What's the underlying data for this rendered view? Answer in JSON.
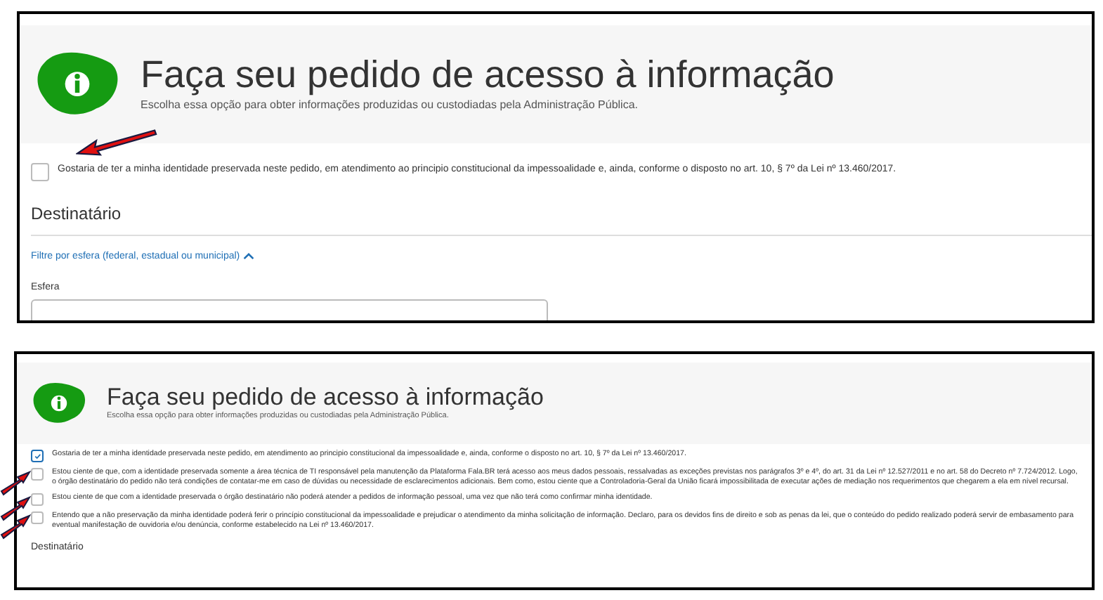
{
  "panels": [
    {
      "header": {
        "title": "Faça seu pedido de acesso à informação",
        "subtitle": "Escolha essa opção para obter informações produzidas ou custodiadas pela Administração Pública."
      },
      "options": [
        {
          "text": "Gostaria de ter a minha identidade preservada neste pedido, em atendimento ao principio constitucional da impessoalidade e, ainda, conforme o disposto no art. 10, § 7º da Lei nº 13.460/2017.",
          "checked": false,
          "marked": true
        }
      ],
      "section": "Destinatário",
      "filter_link": "Filtre por esfera (federal, estadual ou municipal)",
      "field_label": "Esfera"
    },
    {
      "header": {
        "title": "Faça seu pedido de acesso à informação",
        "subtitle": "Escolha essa opção para obter informações produzidas ou custodiadas pela Administração Pública."
      },
      "options": [
        {
          "text": "Gostaria de ter a minha identidade preservada neste pedido, em atendimento ao principio constitucional da impessoalidade e, ainda, conforme o disposto no art. 10, § 7º da Lei nº 13.460/2017.",
          "checked": true,
          "marked": false
        },
        {
          "text": "Estou ciente de que, com a identidade preservada somente a área técnica de TI responsável pela manutenção da Plataforma Fala.BR terá acesso aos meus dados pessoais, ressalvadas as exceções previstas nos parágrafos 3º e 4º, do art. 31 da Lei nº 12.527/2011 e no art. 58 do Decreto nº 7.724/2012. Logo, o órgão destinatário do pedido não terá condições de contatar-me em caso de dúvidas ou necessidade de esclarecimentos adicionais. Bem como, estou ciente que a Controladoria-Geral da União ficará impossibilitada de executar ações de mediação nos requerimentos que chegarem a ela em nível recursal.",
          "checked": false,
          "marked": true
        },
        {
          "text": "Estou ciente de que com a identidade preservada o órgão destinatário não poderá atender a pedidos de informação pessoal, uma vez que não terá como confirmar minha identidade.",
          "checked": false,
          "marked": true
        },
        {
          "text": "Entendo que a não preservação da minha identidade poderá ferir o princípio constitucional da impessoalidade e prejudicar o atendimento da minha solicitação de informação. Declaro, para os devidos fins de direito e sob as penas da lei, que o conteúdo do pedido realizado poderá servir de embasamento para eventual manifestação de ouvidoria e/ou denúncia, conforme estabelecido na Lei nº 13.460/2017.",
          "checked": false,
          "marked": true
        }
      ],
      "section": "Destinatário"
    }
  ]
}
